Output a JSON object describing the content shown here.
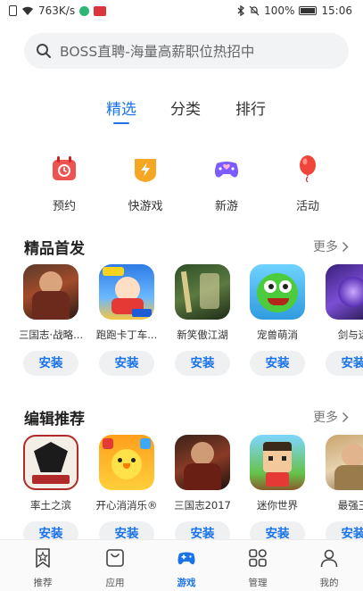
{
  "status_bar": {
    "speed": "763K/s",
    "battery": "100%",
    "time": "15:06"
  },
  "search": {
    "placeholder": "BOSS直聘-海量高薪职位热招中"
  },
  "tabs": [
    {
      "label": "精选",
      "active": true
    },
    {
      "label": "分类",
      "active": false
    },
    {
      "label": "排行",
      "active": false
    }
  ],
  "quick_links": [
    {
      "label": "预约",
      "icon": "calendar-icon",
      "color": "#ef5350"
    },
    {
      "label": "快游戏",
      "icon": "lightning-icon",
      "color": "#f5a623"
    },
    {
      "label": "新游",
      "icon": "gamepad-icon",
      "color": "#7c5cff"
    },
    {
      "label": "活动",
      "icon": "balloon-icon",
      "color": "#f0453a"
    }
  ],
  "sections": [
    {
      "title": "精品首发",
      "more": "更多",
      "apps": [
        {
          "name": "三国志·战略...",
          "button": "安装"
        },
        {
          "name": "跑跑卡丁车...",
          "button": "安装"
        },
        {
          "name": "新笑傲江湖",
          "button": "安装"
        },
        {
          "name": "宠兽萌消",
          "button": "安装"
        },
        {
          "name": "剑与远",
          "button": "安装"
        }
      ]
    },
    {
      "title": "编辑推荐",
      "more": "更多",
      "apps": [
        {
          "name": "率土之滨",
          "button": "安装"
        },
        {
          "name": "开心消消乐®",
          "button": "安装"
        },
        {
          "name": "三国志2017",
          "button": "安装"
        },
        {
          "name": "迷你世界",
          "button": "安装"
        },
        {
          "name": "最强王",
          "button": "安装"
        }
      ]
    }
  ],
  "bottom_nav": [
    {
      "label": "推荐",
      "icon": "star-bookmark-icon",
      "active": false
    },
    {
      "label": "应用",
      "icon": "app-bag-icon",
      "active": false
    },
    {
      "label": "游戏",
      "icon": "gamepad-icon",
      "active": true
    },
    {
      "label": "管理",
      "icon": "grid-icon",
      "active": false
    },
    {
      "label": "我的",
      "icon": "person-icon",
      "active": false
    }
  ],
  "colors": {
    "accent": "#1a73e8",
    "search_bg": "#f1f3f5",
    "button_bg": "#eef0f2"
  }
}
